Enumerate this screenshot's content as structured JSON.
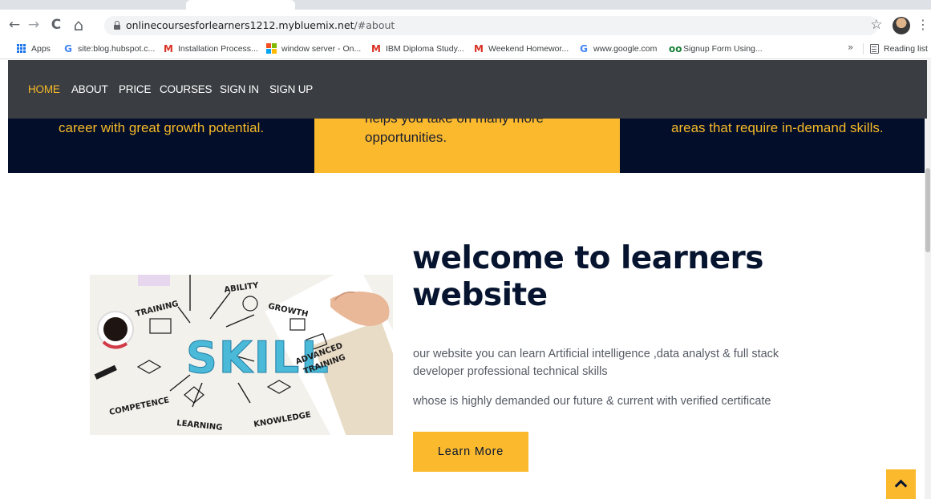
{
  "browser": {
    "back_icon": "←",
    "forward_icon": "→",
    "reload_icon": "C",
    "home_icon": "⌂",
    "url_host": "onlinecoursesforlearners1212.mybluemix.net",
    "url_path": "/#about",
    "star_icon": "☆",
    "menu_icon": "⋮"
  },
  "bookmarks": {
    "items": [
      "Apps",
      "site:blog.hubspot.c...",
      "Installation Process...",
      "window server - On...",
      "IBM Diploma Study...",
      "Weekend Homewor...",
      "www.google.com",
      "Signup Form Using..."
    ],
    "more": "»",
    "reading_list": "Reading list"
  },
  "nav": {
    "items": [
      "HOME",
      "ABOUT",
      "PRICE",
      "COURSES",
      "SIGN IN",
      "SIGN UP"
    ],
    "active": "HOME",
    "colors": {
      "bar": "#3a3d42",
      "active": "#f7b928",
      "link": "#ffffff"
    }
  },
  "features": {
    "left_text": "career with great growth potential.",
    "middle_line1": "helps you take on many more",
    "middle_line2": "opportunities.",
    "right_text": "areas that require in-demand skills."
  },
  "image": {
    "words": [
      "ABILITY",
      "TRAINING",
      "GROWTH",
      "SKILL",
      "ADVANCED",
      "TRAINING",
      "COMPETENCE",
      "LEARNING",
      "KNOWLEDGE"
    ]
  },
  "about": {
    "title_line1": "welcome to learners",
    "title_line2": "website",
    "p1": "our website you can learn Artificial intelligence ,data analyst & full stack developer professional technical skills",
    "p2": "whose is highly demanded our future & current with verified certificate",
    "button": "Learn More"
  },
  "colors": {
    "accent": "#fbb92e",
    "dark": "#020e2a",
    "title": "#061430"
  }
}
